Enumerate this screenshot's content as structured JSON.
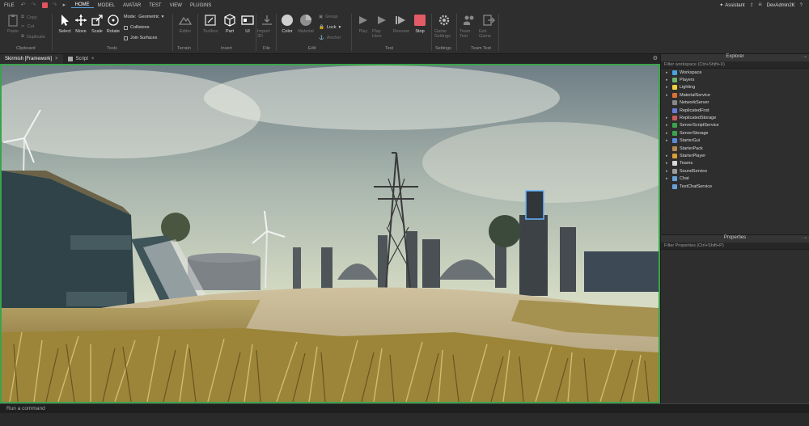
{
  "menubar": {
    "file": "FILE",
    "tabs": [
      "HOME",
      "MODEL",
      "AVATAR",
      "TEST",
      "VIEW",
      "PLUGINS"
    ],
    "active_tab": "HOME",
    "assistant": "Assistant",
    "user": "DevAdmin2K"
  },
  "ribbon": {
    "clipboard": {
      "paste": "Paste",
      "copy": "Copy",
      "cut": "Cut",
      "duplicate": "Duplicate",
      "label": "Clipboard"
    },
    "tools": {
      "select": "Select",
      "move": "Move",
      "scale": "Scale",
      "rotate": "Rotate",
      "mode_label": "Mode:",
      "mode_value": "Geometric",
      "collisions": "Collisions",
      "join_surfaces": "Join Surfaces",
      "label": "Tools"
    },
    "terrain": {
      "editor": "Editor",
      "label": "Terrain"
    },
    "insert": {
      "toolbox": "Toolbox",
      "part": "Part",
      "ui": "UI",
      "label": "Insert"
    },
    "file": {
      "import3d": "Import 3D",
      "label": "File"
    },
    "edit": {
      "color": "Color",
      "material": "Material",
      "group": "Group",
      "lock": "Lock",
      "anchor": "Anchor",
      "label": "Edit"
    },
    "test": {
      "play": "Play",
      "play_here": "Play Here",
      "resume": "Resume",
      "stop": "Stop",
      "label": "Test"
    },
    "settings": {
      "game_settings": "Game Settings",
      "label": "Settings"
    },
    "team_test": {
      "team_test": "Team Test",
      "exit_game": "Exit Game",
      "label": "Team Test"
    }
  },
  "doc_tabs": [
    {
      "label": "Skirmish [Framework]"
    },
    {
      "label": "Script"
    }
  ],
  "explorer": {
    "title": "Explorer",
    "filter": "Filter workspace (Ctrl+Shift+X)",
    "items": [
      {
        "label": "Workspace",
        "expandable": true,
        "color": "#4aa3e0"
      },
      {
        "label": "Players",
        "expandable": true,
        "color": "#6bb36b"
      },
      {
        "label": "Lighting",
        "expandable": true,
        "color": "#f0d040"
      },
      {
        "label": "MaterialService",
        "expandable": true,
        "color": "#d9703a"
      },
      {
        "label": "NetworkServer",
        "expandable": false,
        "color": "#888888"
      },
      {
        "label": "ReplicatedFirst",
        "expandable": false,
        "color": "#6b7bd9"
      },
      {
        "label": "ReplicatedStorage",
        "expandable": true,
        "color": "#c95a5a"
      },
      {
        "label": "ServerScriptService",
        "expandable": true,
        "color": "#3aa34b"
      },
      {
        "label": "ServerStorage",
        "expandable": true,
        "color": "#3aa34b"
      },
      {
        "label": "StarterGui",
        "expandable": true,
        "color": "#5a8ad9"
      },
      {
        "label": "StarterPack",
        "expandable": false,
        "color": "#b08a50"
      },
      {
        "label": "StarterPlayer",
        "expandable": true,
        "color": "#d9a03a"
      },
      {
        "label": "Teams",
        "expandable": true,
        "color": "#d9d9d9"
      },
      {
        "label": "SoundService",
        "expandable": true,
        "color": "#9a9a9a"
      },
      {
        "label": "Chat",
        "expandable": true,
        "color": "#6aa0d9"
      },
      {
        "label": "TextChatService",
        "expandable": false,
        "color": "#6aa0d9"
      }
    ]
  },
  "properties": {
    "title": "Properties",
    "filter": "Filter Properties (Ctrl+Shift+P)"
  },
  "command_bar": {
    "placeholder": "Run a command"
  }
}
